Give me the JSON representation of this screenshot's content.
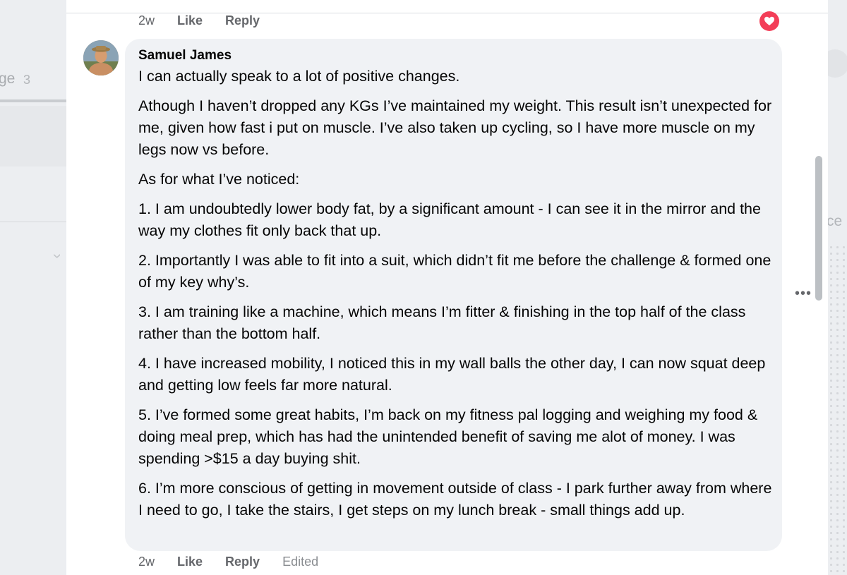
{
  "background": {
    "left_text": "ge",
    "left_count": "3",
    "right_text": "ce"
  },
  "previous_comment": {
    "time": "2w",
    "like_label": "Like",
    "reply_label": "Reply",
    "reaction_icon": "heart-icon",
    "reaction_color": "#f33e58"
  },
  "comment": {
    "author": "Samuel James",
    "paragraphs": [
      "I can actually speak to a lot of positive changes.",
      "Athough I haven’t dropped any KGs I’ve maintained my weight. This result isn’t unexpected for me, given how fast i put on muscle. I’ve also taken up cycling, so I have more muscle on my legs now vs before.",
      "As for what I’ve noticed:",
      "1. I am undoubtedly lower body fat, by a significant amount - I can see it in the mirror and the way my clothes fit only back that up.",
      "2. Importantly I was able to fit into a suit, which didn’t fit me before the challenge & formed one of my key why’s.",
      "3. I am training like a machine, which means I’m fitter & finishing in the top half of the class rather than the bottom half.",
      "4. I have increased mobility, I noticed this in my wall balls the other day, I can now squat deep and getting low feels far more natural.",
      "5. I’ve formed some great habits, I’m back on my fitness pal logging and weighing my food & doing meal prep, which has had the unintended benefit of saving me alot of money. I was spending >$15 a day buying shit.",
      "6. I’m more conscious of getting in movement outside of class - I park further away from where I need to go, I take the stairs, I get steps on my lunch break - small things add up."
    ],
    "time": "2w",
    "like_label": "Like",
    "reply_label": "Reply",
    "edited_label": "Edited",
    "more_icon": "more-horizontal-icon"
  }
}
